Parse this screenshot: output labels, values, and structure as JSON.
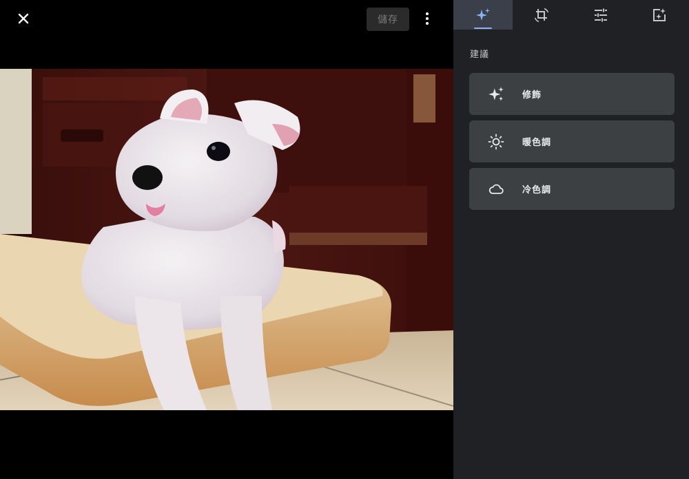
{
  "toolbar": {
    "close_icon": "close-icon",
    "save_label": "儲存",
    "more_icon": "more-vert-icon"
  },
  "tabs": [
    {
      "name": "suggestions",
      "icon": "sparkle-icon",
      "active": true
    },
    {
      "name": "crop-rotate",
      "icon": "crop-rotate-icon",
      "active": false
    },
    {
      "name": "adjust",
      "icon": "sliders-icon",
      "active": false
    },
    {
      "name": "filters",
      "icon": "filter-sparkle-icon",
      "active": false
    }
  ],
  "panel": {
    "section_title": "建議",
    "suggestions": [
      {
        "label": "修飾",
        "icon": "sparkle-icon"
      },
      {
        "label": "暖色調",
        "icon": "sun-icon"
      },
      {
        "label": "冷色調",
        "icon": "cloud-icon"
      }
    ]
  },
  "colors": {
    "panel_bg": "#202124",
    "card_bg": "#3c4043",
    "active_tab_bg": "#3a3f4a",
    "accent": "#8ab4f8"
  }
}
